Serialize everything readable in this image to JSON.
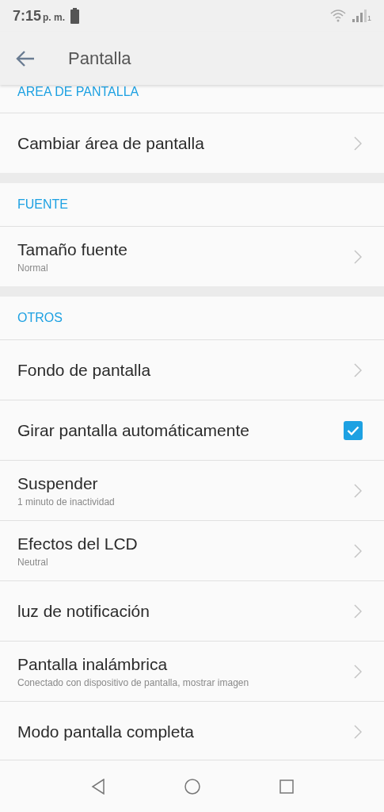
{
  "status_bar": {
    "time": "7:15",
    "period": "p. m.",
    "sim_label": "1"
  },
  "app_bar": {
    "title": "Pantalla"
  },
  "sections": [
    {
      "header": "AREA DE PANTALLA",
      "items": [
        {
          "kind": "link",
          "title": "Cambiar área de pantalla"
        }
      ]
    },
    {
      "header": "FUENTE",
      "items": [
        {
          "kind": "link",
          "title": "Tamaño fuente",
          "subtitle": "Normal"
        }
      ]
    },
    {
      "header": "OTROS",
      "items": [
        {
          "kind": "link",
          "title": "Fondo de pantalla"
        },
        {
          "kind": "checkbox",
          "title": "Girar pantalla automáticamente",
          "checked": true
        },
        {
          "kind": "link",
          "title": "Suspender",
          "subtitle": "1 minuto de inactividad"
        },
        {
          "kind": "link",
          "title": "Efectos del LCD",
          "subtitle": "Neutral"
        },
        {
          "kind": "link",
          "title": "luz de notificación"
        },
        {
          "kind": "link",
          "title": "Pantalla inalámbrica",
          "subtitle": "Conectado con dispositivo de pantalla, mostrar imagen"
        },
        {
          "kind": "link",
          "title": "Modo pantalla completa"
        }
      ]
    }
  ]
}
